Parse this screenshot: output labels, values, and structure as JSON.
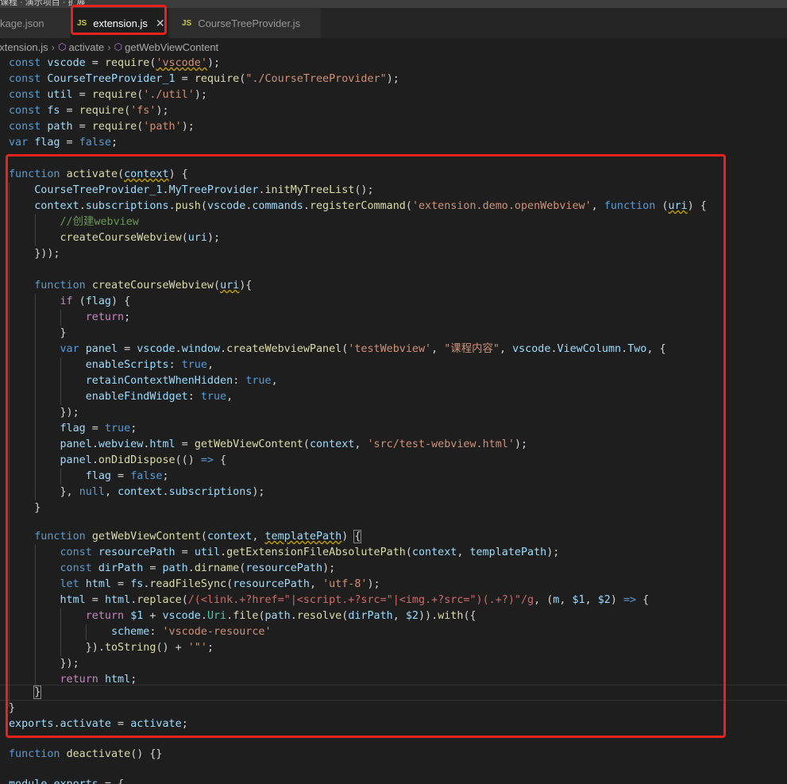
{
  "topbar_fragment": "课程 · 演示项目 · 扩展",
  "tabs": [
    {
      "label": "package.json",
      "visible": "kage.json",
      "active": false
    },
    {
      "label": "extension.js",
      "active": true
    },
    {
      "label": "CourseTreeProvider.js",
      "active": false
    }
  ],
  "breadcrumb": [
    "extension.js",
    "activate",
    "getWebViewContent"
  ],
  "colors": {
    "highlight": "#e8231d",
    "keyword": "#569cd6",
    "string": "#ce9178",
    "function": "#dcdcaa",
    "variable": "#9cdcfe"
  },
  "code_lines": [
    "const vscode = require('vscode');",
    "const CourseTreeProvider_1 = require(\"./CourseTreeProvider\");",
    "const util = require('./util');",
    "const fs = require('fs');",
    "const path = require('path');",
    "var flag = false;",
    "",
    "function activate(context) {",
    "    CourseTreeProvider_1.MyTreeProvider.initMyTreeList();",
    "    context.subscriptions.push(vscode.commands.registerCommand('extension.demo.openWebview', function (uri) {",
    "        //创建webview",
    "        createCourseWebview(uri);",
    "    }));",
    "",
    "    function createCourseWebview(uri){",
    "        if (flag) {",
    "            return;",
    "        }",
    "        var panel = vscode.window.createWebviewPanel('testWebview', \"课程内容\", vscode.ViewColumn.Two, {",
    "            enableScripts: true,",
    "            retainContextWhenHidden: true,",
    "            enableFindWidget: true,",
    "        });",
    "        flag = true;",
    "        panel.webview.html = getWebViewContent(context, 'src/test-webview.html');",
    "        panel.onDidDispose(() => {",
    "            flag = false;",
    "        }, null, context.subscriptions);",
    "    }",
    "",
    "    function getWebViewContent(context, templatePath) {",
    "        const resourcePath = util.getExtensionFileAbsolutePath(context, templatePath);",
    "        const dirPath = path.dirname(resourcePath);",
    "        let html = fs.readFileSync(resourcePath, 'utf-8');",
    "        html = html.replace(/(<link.+?href=\"|<script.+?src=\"|<img.+?src=\")(.+?)\"/g, (m, $1, $2) => {",
    "            return $1 + vscode.Uri.file(path.resolve(dirPath, $2)).with({",
    "                scheme: 'vscode-resource'",
    "            }).toString() + '\"';",
    "        });",
    "        return html;",
    "    }",
    "}",
    "exports.activate = activate;",
    "",
    "function deactivate() {}",
    "",
    "module.exports = {"
  ]
}
